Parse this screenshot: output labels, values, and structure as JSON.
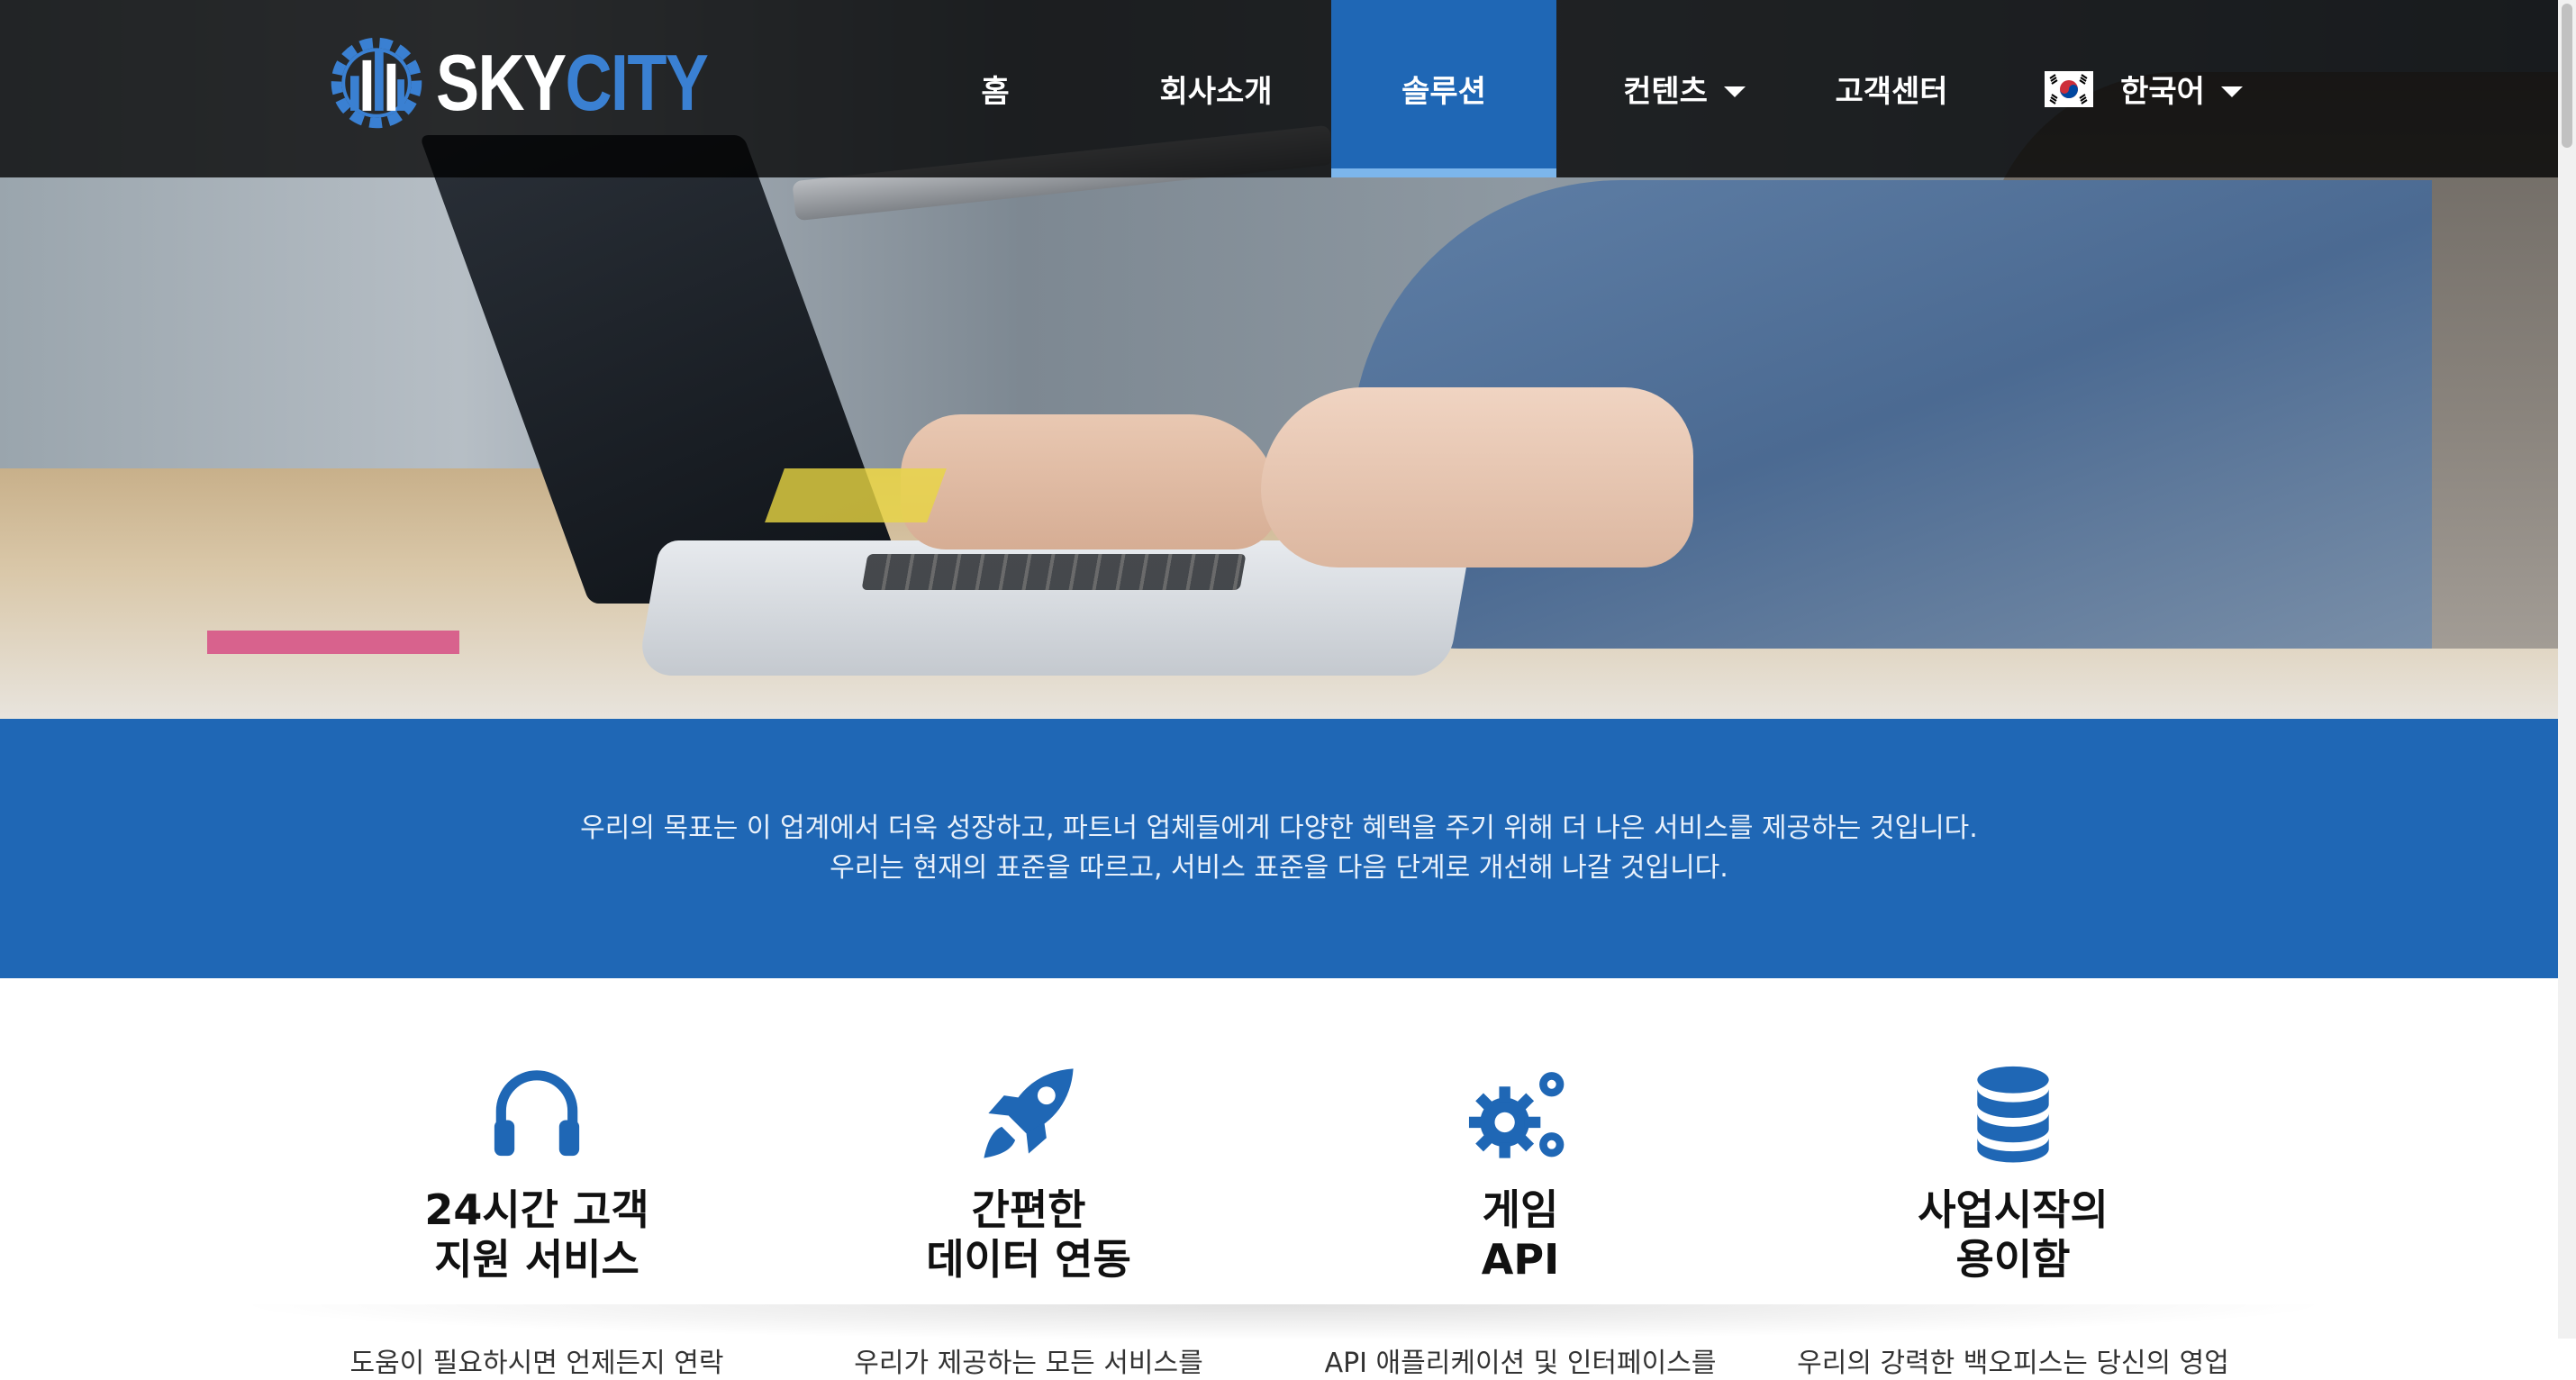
{
  "brand": {
    "sky": "SKY",
    "city": "CITY",
    "accent": "#3a80d2"
  },
  "nav": {
    "home": "홈",
    "about": "회사소개",
    "solutions": "솔루션",
    "contents": "컨텐츠",
    "support": "고객센터",
    "language": "한국어",
    "active": "솔루션",
    "active_color": "#1f67b5"
  },
  "intro": {
    "line1": "우리의 목표는 이 업계에서 더욱 성장하고, 파트너 업체들에게 다양한 혜택을 주기 위해 더 나은 서비스를 제공하는 것입니다.",
    "line2": "우리는 현재의 표준을 따르고, 서비스 표준을 다음 단계로 개선해 나갈 것입니다."
  },
  "features": [
    {
      "icon": "headphones-icon",
      "title": "24시간 고객\n지원 서비스",
      "desc": "도움이 필요하시면 언제든지 연락"
    },
    {
      "icon": "rocket-icon",
      "title": "간편한\n데이터 연동",
      "desc": "우리가 제공하는 모든 서비스를"
    },
    {
      "icon": "gears-icon",
      "title": "게임\nAPI",
      "desc": "API 애플리케이션 및 인터페이스를"
    },
    {
      "icon": "database-icon",
      "title": "사업시작의\n용이함",
      "desc": "우리의 강력한 백오피스는 당신의 영업"
    }
  ]
}
